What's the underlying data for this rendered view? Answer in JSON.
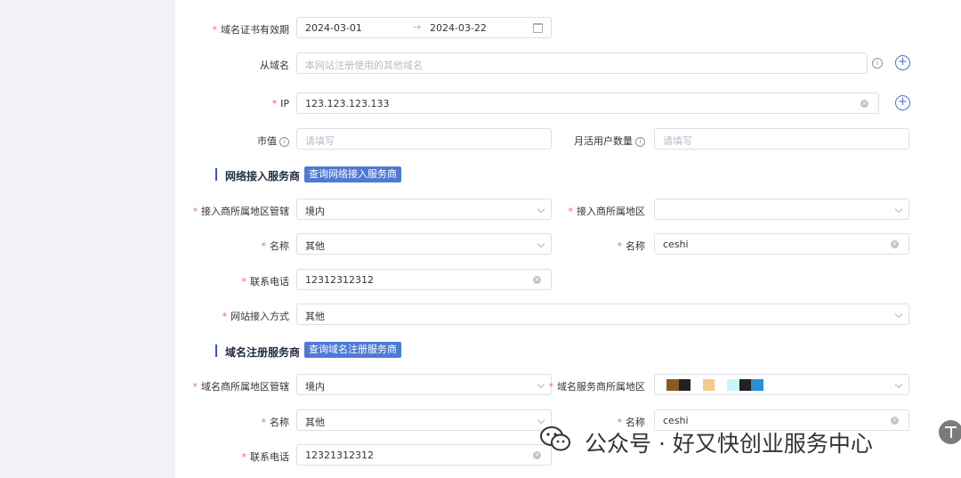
{
  "fields": {
    "cert_validity": {
      "label": "域名证书有效期",
      "start": "2024-03-01",
      "end": "2024-03-22"
    },
    "sub_domain": {
      "label": "从域名",
      "placeholder": "本网站注册使用的其他域名"
    },
    "ip": {
      "label": "IP",
      "value": "123.123.123.133"
    },
    "market_value": {
      "label": "市值",
      "placeholder": "请填写"
    },
    "monthly_users": {
      "label": "月活用户数量",
      "placeholder": "请填写"
    }
  },
  "network_section": {
    "title": "网络接入服务商",
    "query_button": "查询网络接入服务商",
    "region_jurisdiction": {
      "label": "接入商所属地区管辖",
      "value": "境内"
    },
    "region": {
      "label": "接入商所属地区",
      "value": ""
    },
    "name": {
      "label": "名称",
      "value": "其他"
    },
    "name_right": {
      "label": "名称",
      "value": "ceshi"
    },
    "phone": {
      "label": "联系电话",
      "value": "12312312312"
    },
    "access_method": {
      "label": "网站接入方式",
      "value": "其他"
    }
  },
  "registrar_section": {
    "title": "域名注册服务商",
    "query_button": "查询域名注册服务商",
    "region_jurisdiction": {
      "label": "域名商所属地区管辖",
      "value": "境内"
    },
    "region": {
      "label": "域名服务商所属地区",
      "value": ""
    },
    "name": {
      "label": "名称",
      "value": "其他"
    },
    "name_right": {
      "label": "名称",
      "value": "ceshi"
    },
    "phone": {
      "label": "联系电话",
      "value": "12321312312"
    }
  },
  "redaction_colors": [
    "#8b5a1e",
    "#222222",
    "#f7c98a",
    "#c8f7fa",
    "#222222",
    "#2a8fd4"
  ],
  "watermark": {
    "text": "公众号 · 好又快创业服务中心"
  },
  "icons": {
    "info": "info-icon",
    "add": "plus-circle-icon",
    "clear": "clear-icon",
    "calendar": "calendar-icon",
    "chevron": "chevron-down-icon",
    "back_to_top": "back-to-top-icon"
  }
}
